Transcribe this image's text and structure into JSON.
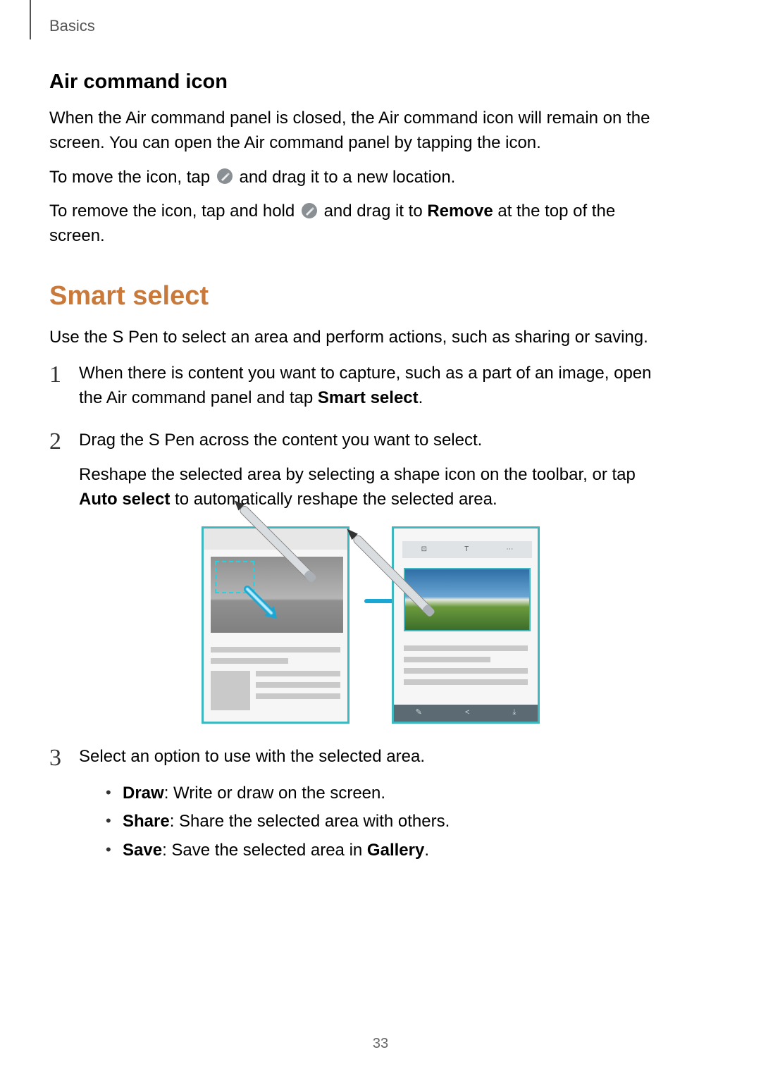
{
  "header": {
    "section": "Basics"
  },
  "subhead1": "Air command icon",
  "para1": "When the Air command panel is closed, the Air command icon will remain on the screen. You can open the Air command panel by tapping the icon.",
  "move_pre": "To move the icon, tap ",
  "move_post": " and drag it to a new location.",
  "remove_pre": "To remove the icon, tap and hold ",
  "remove_mid": " and drag it to ",
  "remove_bold": "Remove",
  "remove_post": " at the top of the screen.",
  "section2": "Smart select",
  "para2": "Use the S Pen to select an area and perform actions, such as sharing or saving.",
  "steps": [
    {
      "num": "1",
      "p1a": "When there is content you want to capture, such as a part of an image, open the Air command panel and tap ",
      "p1b": "Smart select",
      "p1c": "."
    },
    {
      "num": "2",
      "p1": "Drag the S Pen across the content you want to select.",
      "p2a": "Reshape the selected area by selecting a shape icon on the toolbar, or tap ",
      "p2b": "Auto select",
      "p2c": " to automatically reshape the selected area."
    },
    {
      "num": "3",
      "p1": "Select an option to use with the selected area.",
      "opts": [
        {
          "b": "Draw",
          "t": ": Write or draw on the screen."
        },
        {
          "b": "Share",
          "t": ": Share the selected area with others."
        },
        {
          "b": "Save",
          "t_a": ": Save the selected area in ",
          "t_bold": "Gallery",
          "t_c": "."
        }
      ]
    }
  ],
  "page": "33"
}
